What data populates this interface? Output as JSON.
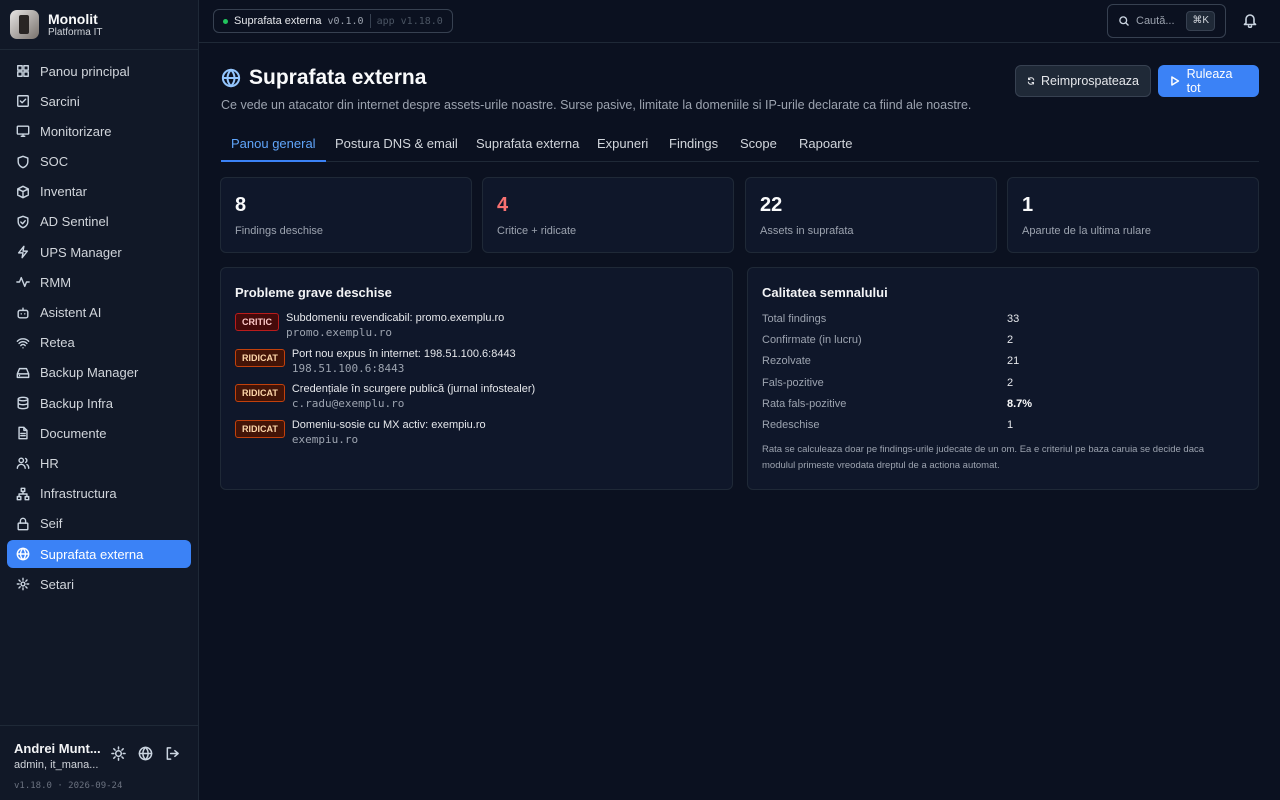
{
  "brand": {
    "name": "Monolit",
    "subtitle": "Platforma IT"
  },
  "sidebar": {
    "items": [
      {
        "label": "Panou principal",
        "icon": "dashboard-icon"
      },
      {
        "label": "Sarcini",
        "icon": "checkbox-icon"
      },
      {
        "label": "Monitorizare",
        "icon": "monitor-icon"
      },
      {
        "label": "SOC",
        "icon": "shield-icon"
      },
      {
        "label": "Inventar",
        "icon": "box-icon"
      },
      {
        "label": "AD Sentinel",
        "icon": "shield-check-icon"
      },
      {
        "label": "UPS Manager",
        "icon": "lightning-icon"
      },
      {
        "label": "RMM",
        "icon": "activity-icon"
      },
      {
        "label": "Asistent AI",
        "icon": "bot-icon"
      },
      {
        "label": "Retea",
        "icon": "wifi-icon"
      },
      {
        "label": "Backup Manager",
        "icon": "hard-drive-icon"
      },
      {
        "label": "Backup Infra",
        "icon": "database-icon"
      },
      {
        "label": "Documente",
        "icon": "file-icon"
      },
      {
        "label": "HR",
        "icon": "users-icon"
      },
      {
        "label": "Infrastructura",
        "icon": "network-icon"
      },
      {
        "label": "Seif",
        "icon": "lock-icon"
      },
      {
        "label": "Suprafata externa",
        "icon": "globe-icon",
        "active": true
      },
      {
        "label": "Setari",
        "icon": "gear-icon"
      }
    ]
  },
  "user": {
    "name": "Andrei Munt...",
    "role": "admin, it_mana...",
    "version": "v1.18.0 · 2026-09-24"
  },
  "topbar": {
    "crumb": "Suprafata externa",
    "module_version": "v0.1.0",
    "app_version": "app v1.18.0",
    "search_placeholder": "Caută...",
    "shortcut": "⌘K"
  },
  "page": {
    "title": "Suprafata externa",
    "subtitle": "Ce vede un atacator din internet despre assets-urile noastre. Surse pasive, limitate la domeniile si IP-urile declarate ca fiind ale noastre.",
    "refresh_label": "Reimprospateaza",
    "run_label": "Ruleaza tot"
  },
  "tabs": [
    "Panou general",
    "Postura DNS & email",
    "Suprafata externa",
    "Expuneri",
    "Findings",
    "Scope",
    "Rapoarte"
  ],
  "stats": [
    {
      "value": "8",
      "label": "Findings deschise"
    },
    {
      "value": "4",
      "label": "Critice + ridicate",
      "accent": "#f87171"
    },
    {
      "value": "22",
      "label": "Assets in suprafata"
    },
    {
      "value": "1",
      "label": "Aparute de la ultima rulare"
    }
  ],
  "issues": {
    "title": "Probleme grave deschise",
    "items": [
      {
        "severity": "CRITIC",
        "title": "Subdomeniu revendicabil: promo.exemplu.ro",
        "target": "promo.exemplu.ro"
      },
      {
        "severity": "RIDICAT",
        "title": "Port nou expus în internet: 198.51.100.6:8443",
        "target": "198.51.100.6:8443"
      },
      {
        "severity": "RIDICAT",
        "title": "Credențiale în scurgere publică (jurnal infostealer)",
        "target": "c.radu@exemplu.ro"
      },
      {
        "severity": "RIDICAT",
        "title": "Domeniu-sosie cu MX activ: exempiu.ro",
        "target": "exempiu.ro"
      }
    ]
  },
  "quality": {
    "title": "Calitatea semnalului",
    "rows": [
      {
        "label": "Total findings",
        "value": "33"
      },
      {
        "label": "Confirmate (in lucru)",
        "value": "2"
      },
      {
        "label": "Rezolvate",
        "value": "21"
      },
      {
        "label": "Fals-pozitive",
        "value": "2"
      },
      {
        "label": "Rata fals-pozitive",
        "value": "8.7%"
      },
      {
        "label": "Redeschise",
        "value": "1"
      }
    ],
    "note": "Rata se calculeaza doar pe findings-urile judecate de un om. Ea e criteriul pe baza caruia se decide daca modulul primeste vreodata dreptul de a actiona automat."
  },
  "colors": {
    "accent": "#3b82f6",
    "critical": "#b91c1c",
    "high": "#c2410c",
    "online": "#22c55e"
  }
}
